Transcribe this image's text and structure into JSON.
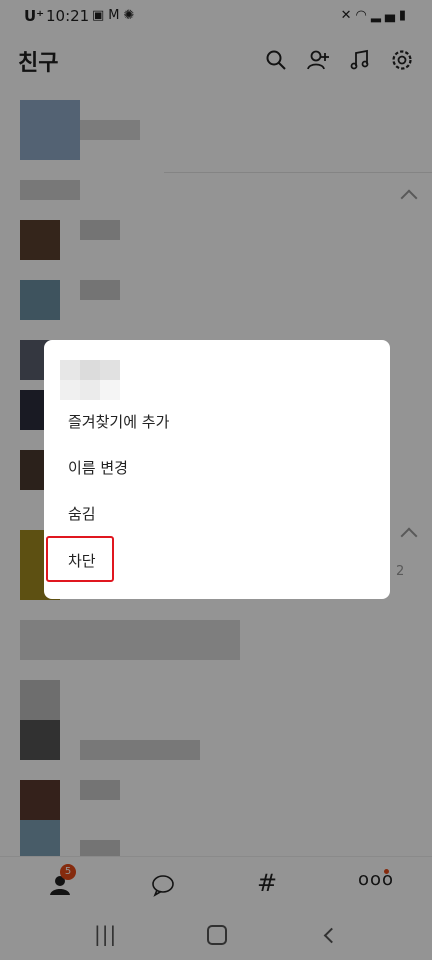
{
  "status_bar": {
    "carrier": "U⁺",
    "time": "10:21",
    "left_icons": [
      "image-icon",
      "gmail-icon",
      "sync-icon"
    ],
    "right_icons": [
      "mute-icon",
      "wifi-icon",
      "signal-icon",
      "battery-icon"
    ]
  },
  "header": {
    "title": "친구",
    "icons": [
      "search-icon",
      "add-friend-icon",
      "music-icon",
      "settings-icon"
    ]
  },
  "list": {
    "section_count": "2"
  },
  "dialog": {
    "items": [
      {
        "label": "즐겨찾기에 추가"
      },
      {
        "label": "이름 변경"
      },
      {
        "label": "숨김"
      },
      {
        "label": "차단"
      }
    ],
    "highlighted_item": "차단",
    "highlight_color": "#e0161f"
  },
  "tab_bar": {
    "tabs": [
      "friends-icon",
      "chat-icon",
      "hashtag-icon",
      "more-icon"
    ],
    "friends_badge": "5",
    "badge_color": "#e64a19"
  },
  "nav_bar": {
    "buttons": [
      "recent-apps-icon",
      "home-icon",
      "back-icon"
    ]
  }
}
